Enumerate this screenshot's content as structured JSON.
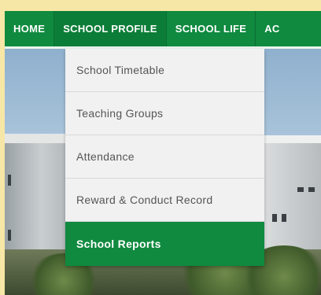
{
  "nav": {
    "items": [
      {
        "label": "HOME"
      },
      {
        "label": "SCHOOL PROFILE"
      },
      {
        "label": "SCHOOL LIFE"
      },
      {
        "label": "AC"
      }
    ]
  },
  "dropdown": {
    "items": [
      {
        "label": "School Timetable"
      },
      {
        "label": "Teaching Groups"
      },
      {
        "label": "Attendance"
      },
      {
        "label": "Reward & Conduct Record"
      },
      {
        "label": "School Reports"
      }
    ],
    "selected": "School Reports"
  },
  "colors": {
    "brand_green": "#0f8a3f",
    "page_background": "#f7e7a6",
    "dropdown_background": "#f1f1f1",
    "dropdown_text": "#555555"
  }
}
